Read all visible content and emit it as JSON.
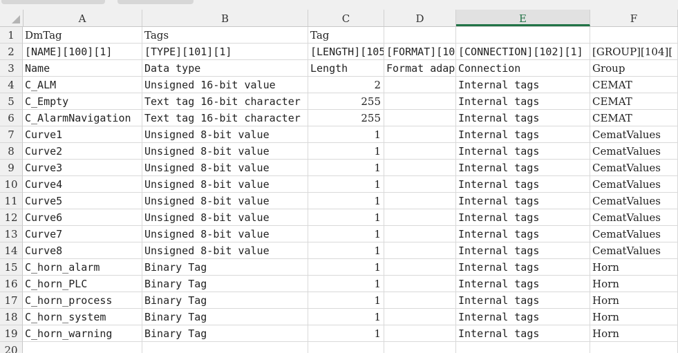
{
  "columns": [
    "A",
    "B",
    "C",
    "D",
    "E",
    "F"
  ],
  "selected_column": "E",
  "rows": [
    {
      "n": "1",
      "A": "DmTag",
      "B": "Tags",
      "C": "Tag",
      "D": "",
      "E": "",
      "F": ""
    },
    {
      "n": "2",
      "A": "[NAME][100][1]",
      "B": "[TYPE][101][1]",
      "C": "[LENGTH][105",
      "D": "[FORMAT][10",
      "E": "[CONNECTION][102][1]",
      "F": "[GROUP][104]["
    },
    {
      "n": "3",
      "A": "Name",
      "B": "Data type",
      "C": "Length",
      "D": "Format adap",
      "E": "Connection",
      "F": "Group"
    },
    {
      "n": "4",
      "A": "C_ALM",
      "B": "Unsigned 16-bit value",
      "C": "2",
      "D": "",
      "E": "Internal tags",
      "F": "CEMAT"
    },
    {
      "n": "5",
      "A": "C_Empty",
      "B": "Text tag 16-bit character",
      "C": "255",
      "D": "",
      "E": "Internal tags",
      "F": "CEMAT"
    },
    {
      "n": "6",
      "A": "C_AlarmNavigation",
      "B": "Text tag 16-bit character",
      "C": "255",
      "D": "",
      "E": "Internal tags",
      "F": "CEMAT"
    },
    {
      "n": "7",
      "A": "Curve1",
      "B": "Unsigned 8-bit value",
      "C": "1",
      "D": "",
      "E": "Internal tags",
      "F": "CematValues"
    },
    {
      "n": "8",
      "A": "Curve2",
      "B": "Unsigned 8-bit value",
      "C": "1",
      "D": "",
      "E": "Internal tags",
      "F": "CematValues"
    },
    {
      "n": "9",
      "A": "Curve3",
      "B": "Unsigned 8-bit value",
      "C": "1",
      "D": "",
      "E": "Internal tags",
      "F": "CematValues"
    },
    {
      "n": "10",
      "A": "Curve4",
      "B": "Unsigned 8-bit value",
      "C": "1",
      "D": "",
      "E": "Internal tags",
      "F": "CematValues"
    },
    {
      "n": "11",
      "A": "Curve5",
      "B": "Unsigned 8-bit value",
      "C": "1",
      "D": "",
      "E": "Internal tags",
      "F": "CematValues"
    },
    {
      "n": "12",
      "A": "Curve6",
      "B": "Unsigned 8-bit value",
      "C": "1",
      "D": "",
      "E": "Internal tags",
      "F": "CematValues"
    },
    {
      "n": "13",
      "A": "Curve7",
      "B": "Unsigned 8-bit value",
      "C": "1",
      "D": "",
      "E": "Internal tags",
      "F": "CematValues"
    },
    {
      "n": "14",
      "A": "Curve8",
      "B": "Unsigned 8-bit value",
      "C": "1",
      "D": "",
      "E": "Internal tags",
      "F": "CematValues"
    },
    {
      "n": "15",
      "A": "C_horn_alarm",
      "B": "Binary Tag",
      "C": "1",
      "D": "",
      "E": "Internal tags",
      "F": "Horn"
    },
    {
      "n": "16",
      "A": "C_horn_PLC",
      "B": "Binary Tag",
      "C": "1",
      "D": "",
      "E": "Internal tags",
      "F": "Horn"
    },
    {
      "n": "17",
      "A": "C_horn_process",
      "B": "Binary Tag",
      "C": "1",
      "D": "",
      "E": "Internal tags",
      "F": "Horn"
    },
    {
      "n": "18",
      "A": "C_horn_system",
      "B": "Binary Tag",
      "C": "1",
      "D": "",
      "E": "Internal tags",
      "F": "Horn"
    },
    {
      "n": "19",
      "A": "C_horn_warning",
      "B": "Binary Tag",
      "C": "1",
      "D": "",
      "E": "Internal tags",
      "F": "Horn"
    },
    {
      "n": "20",
      "A": "",
      "B": "",
      "C": "",
      "D": "",
      "E": "",
      "F": ""
    }
  ],
  "colors": {
    "header_bg": "#f0f0f0",
    "selected_col_accent": "#217346",
    "grid": "#d9d9d9"
  }
}
